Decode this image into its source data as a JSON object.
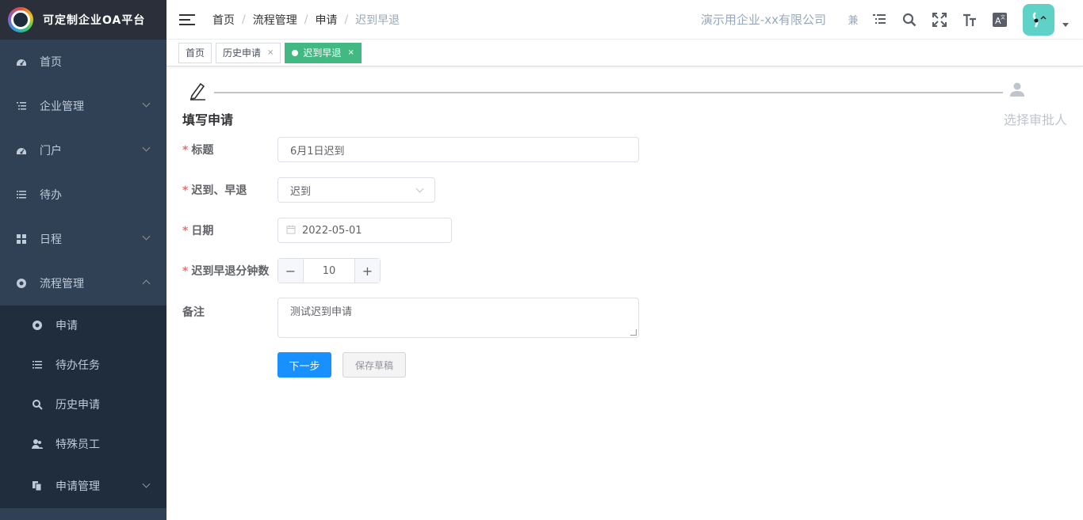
{
  "app": {
    "title": "可定制企业OA平台"
  },
  "sidebar": {
    "items": [
      {
        "label": "首页",
        "icon": "dashboard-icon"
      },
      {
        "label": "企业管理",
        "icon": "tree-list-icon"
      },
      {
        "label": "门户",
        "icon": "dashboard-icon"
      },
      {
        "label": "待办",
        "icon": "list-icon"
      },
      {
        "label": "日程",
        "icon": "grid-icon"
      },
      {
        "label": "流程管理",
        "icon": "aperture-icon"
      }
    ],
    "subitems": [
      {
        "label": "申请",
        "icon": "aperture-icon"
      },
      {
        "label": "待办任务",
        "icon": "list-icon"
      },
      {
        "label": "历史申请",
        "icon": "search-icon"
      },
      {
        "label": "特殊员工",
        "icon": "people-icon"
      },
      {
        "label": "申请管理",
        "icon": "documents-icon"
      }
    ]
  },
  "navbar": {
    "breadcrumb": [
      "首页",
      "流程管理",
      "申请",
      "迟到早退"
    ],
    "company": "演示用企业-xx有限公司",
    "small_label": "兼"
  },
  "tags": [
    {
      "label": "首页"
    },
    {
      "label": "历史申请",
      "close": "×"
    },
    {
      "label": "迟到早退",
      "close": "×",
      "active": true
    }
  ],
  "steps": {
    "left_title": "填写申请",
    "right_title": "选择审批人"
  },
  "form": {
    "title_label": "标题",
    "title_value": "6月1日迟到",
    "type_label": "迟到、早退",
    "type_value": "迟到",
    "date_label": "日期",
    "date_value": "2022-05-01",
    "minutes_label": "迟到早退分钟数",
    "minutes_value": "10",
    "minus": "−",
    "plus": "+",
    "remark_label": "备注",
    "remark_value": "测试迟到申请",
    "required_mark": "*"
  },
  "buttons": {
    "next": "下一步",
    "save_draft": "保存草稿"
  },
  "colors": {
    "sidebar_bg": "#304156",
    "tag_active": "#42b983",
    "primary": "#1890ff"
  }
}
